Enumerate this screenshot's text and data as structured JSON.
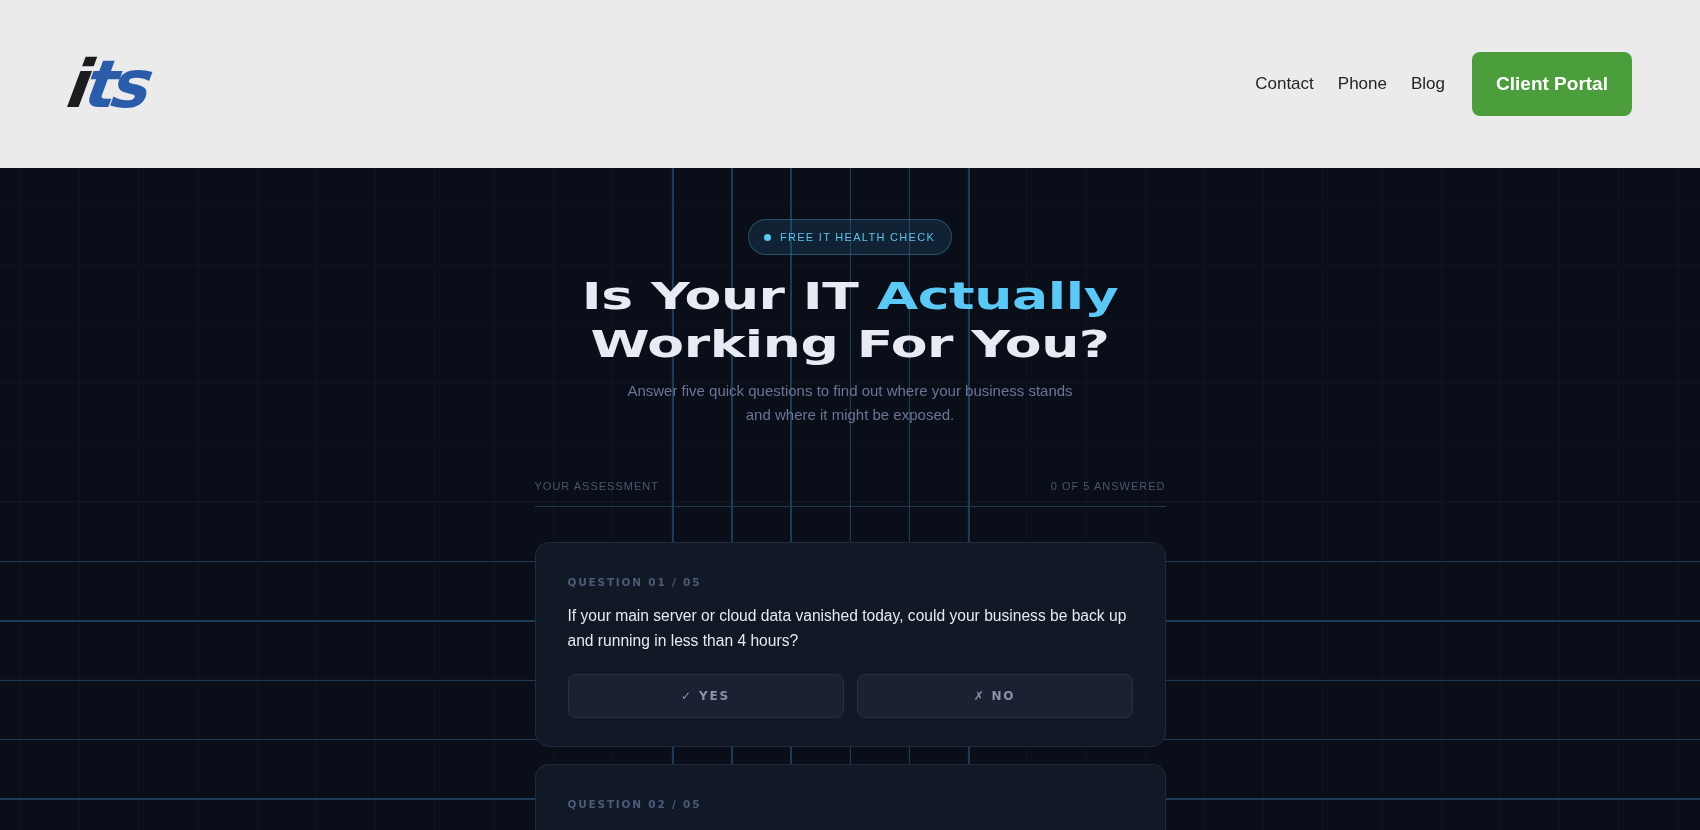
{
  "header": {
    "logo": [
      {
        "text": "i",
        "accent": false
      },
      {
        "text": "ts",
        "accent": true
      }
    ],
    "nav_links": [
      "Contact",
      "Phone",
      "Blog"
    ],
    "portal_button": "Client Portal"
  },
  "hero": {
    "badge": "FREE IT HEALTH CHECK",
    "headline": [
      {
        "text": "Is Your IT ",
        "accent": false
      },
      {
        "text": "Actually",
        "accent": true
      },
      {
        "text": " Working For You?",
        "accent": false
      }
    ],
    "subtitle": "Answer five quick questions to find out where your business stands and where it might be exposed."
  },
  "assessment": {
    "label": "YOUR ASSESSMENT",
    "answered": "0 OF 5 ANSWERED",
    "questions": [
      {
        "label": "QUESTION 01 / 05",
        "text": "If your main server or cloud data vanished today, could your business be back up and running in less than 4 hours?",
        "answers": [
          {
            "label": "✓ YES",
            "selected": false
          },
          {
            "label": "✗ NO",
            "selected": false
          }
        ]
      },
      {
        "label": "QUESTION 02 / 05"
      }
    ]
  }
}
